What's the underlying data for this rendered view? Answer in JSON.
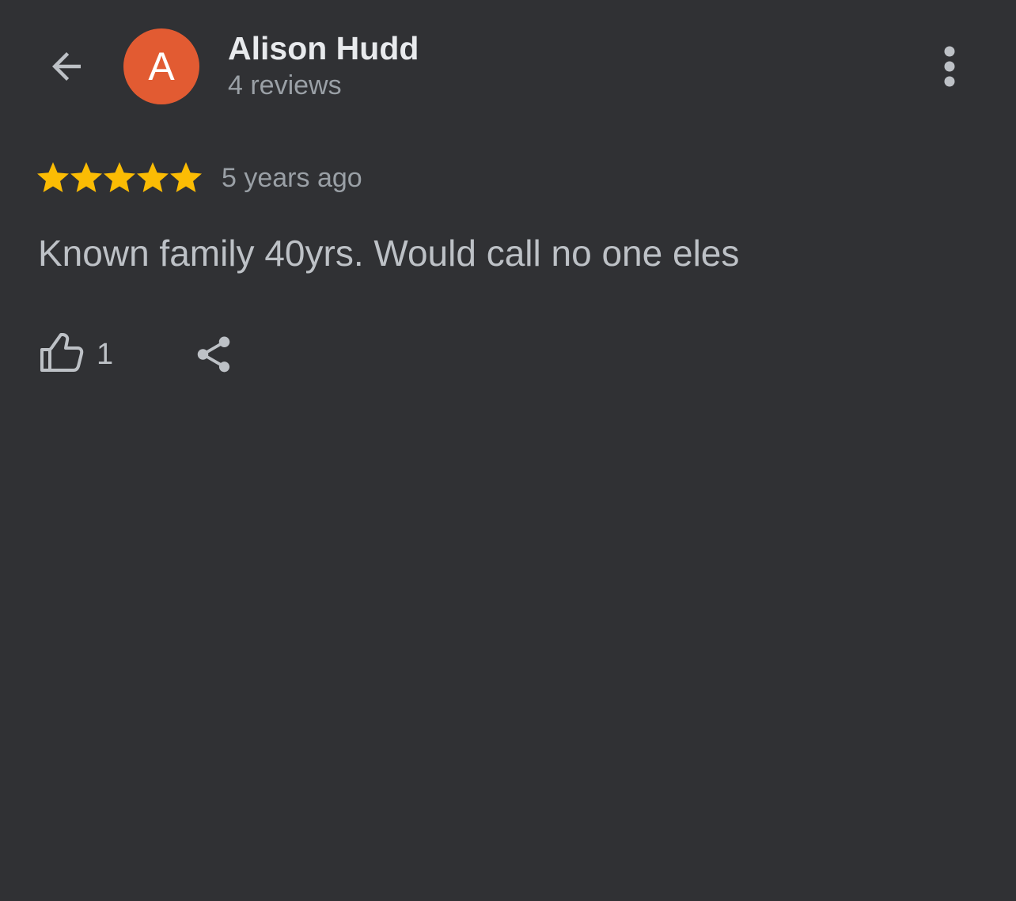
{
  "header": {
    "back_icon": "arrow-back-icon",
    "avatar": {
      "initial": "A",
      "color": "#e25b32"
    },
    "name": "Alison Hudd",
    "review_count": "4 reviews",
    "menu_icon": "more-vert-icon"
  },
  "review": {
    "rating": 5,
    "rating_max": 5,
    "star_color": "#fbbc04",
    "time": "5 years ago",
    "text": "Known family 40yrs. Would call no one eles"
  },
  "actions": {
    "like_icon": "thumb-up-icon",
    "like_count": "1",
    "share_icon": "share-icon"
  },
  "colors": {
    "background": "#303134",
    "primary_text": "#e8eaed",
    "secondary_text": "#9aa0a6",
    "icon": "#bdc1c6"
  }
}
